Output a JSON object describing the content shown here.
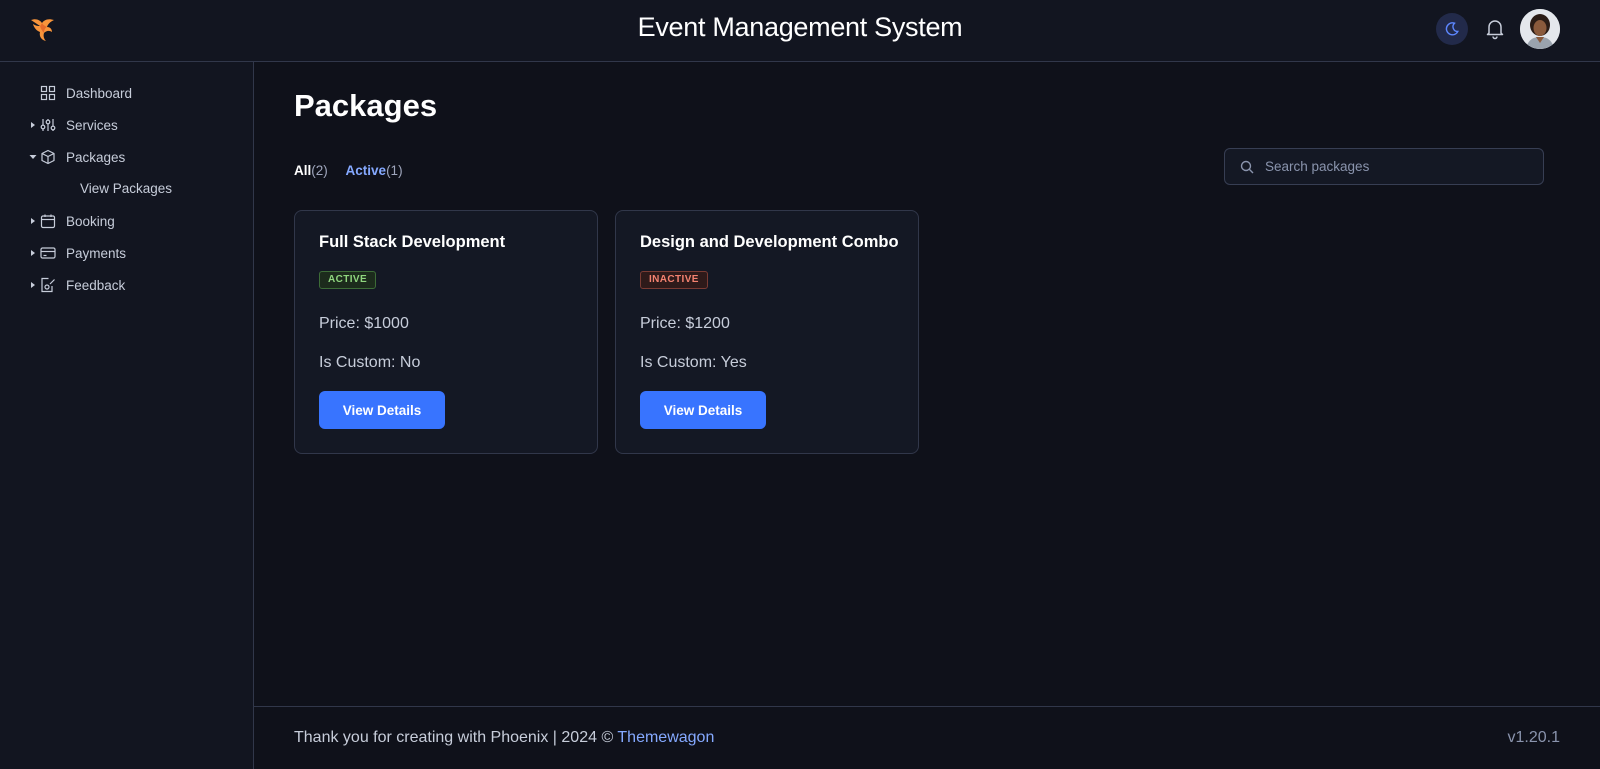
{
  "header": {
    "app_title": "Event Management System",
    "logo_icon": "phoenix-logo-icon",
    "theme_icon": "moon-icon",
    "notification_icon": "bell-icon",
    "accent_color": "#3874ff"
  },
  "sidebar": {
    "items": [
      {
        "label": "Dashboard",
        "icon": "grid-icon"
      },
      {
        "label": "Services",
        "icon": "sliders-icon"
      },
      {
        "label": "Packages",
        "icon": "package-icon",
        "expanded": true
      },
      {
        "label": "Booking",
        "icon": "calendar-icon"
      },
      {
        "label": "Payments",
        "icon": "credit-card-icon"
      },
      {
        "label": "Feedback",
        "icon": "feedback-icon"
      }
    ],
    "sub_items": [
      {
        "label": "View Packages"
      }
    ]
  },
  "main": {
    "title": "Packages",
    "tabs": [
      {
        "label": "All",
        "count": "(2)",
        "selected": true
      },
      {
        "label": "Active",
        "count": "(1)",
        "selected": false
      }
    ],
    "search": {
      "placeholder": "Search packages",
      "value": ""
    },
    "packages": [
      {
        "name": "Full Stack Development",
        "status": "ACTIVE",
        "price": "Price: $1000",
        "custom": "Is Custom: No",
        "button": "View Details"
      },
      {
        "name": "Design and Development Combo",
        "status": "INACTIVE",
        "price": "Price: $1200",
        "custom": "Is Custom: Yes",
        "button": "View Details"
      }
    ]
  },
  "footer": {
    "text": "Thank you for creating with Phoenix | 2024 © ",
    "link": "Themewagon",
    "version": "v1.20.1"
  }
}
